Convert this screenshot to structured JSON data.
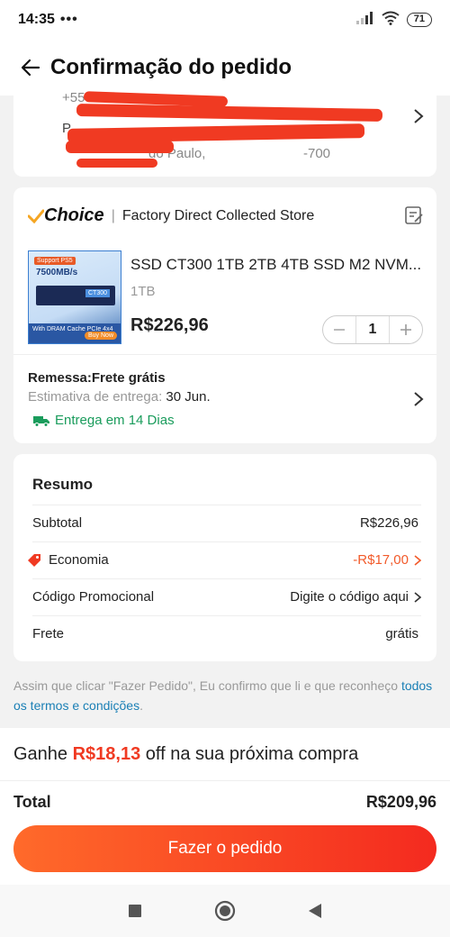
{
  "status_bar": {
    "time": "14:35",
    "dots": "•••",
    "battery": "71"
  },
  "header": {
    "title": "Confirmação do pedido"
  },
  "address": {
    "phone_partial": "+55 ",
    "line2_partial": "P",
    "line3_partial": "do Paulo, ",
    "line3_suffix": "-700"
  },
  "store": {
    "brand": "Choice",
    "separator": "|",
    "name": "Factory Direct Collected Store"
  },
  "product": {
    "title": "SSD CT300 1TB 2TB 4TB SSD M2 NVM...",
    "variant": "1TB",
    "price": "R$226,96",
    "quantity": "1",
    "image_texts": {
      "tag": "Support PS5",
      "speed": "7500MB/s",
      "label": "CT300",
      "bottom": "With DRAM Cache PCIe 4x4",
      "buy": "Buy Now"
    }
  },
  "shipping": {
    "title": "Remessa:Frete grátis",
    "estimate_label": "Estimativa de entrega: ",
    "estimate_date": "30 Jun.",
    "delivery_days": "Entrega em 14 Dias"
  },
  "summary": {
    "title": "Resumo",
    "rows": [
      {
        "label": "Subtotal",
        "value": "R$226,96"
      },
      {
        "label": "Economia",
        "value": "-R$17,00"
      },
      {
        "label": "Código Promocional",
        "value": "Digite o código aqui"
      },
      {
        "label": "Frete",
        "value": "grátis"
      }
    ]
  },
  "legal": {
    "text": "Assim que clicar \"Fazer Pedido\", Eu confirmo que li e que reconheço ",
    "link": "todos os termos e condições",
    "end": "."
  },
  "bottom": {
    "earn_prefix": "Ganhe ",
    "earn_amount": "R$18,13",
    "earn_suffix": " off na sua próxima compra",
    "total_label": "Total",
    "total_value": "R$209,96",
    "order_button": "Fazer o pedido"
  },
  "colors": {
    "accent": "#f03a22",
    "success": "#1a9c5c",
    "link": "#1a7fb5",
    "choice_check": "#f5a623"
  },
  "icons": [
    "back-arrow-icon",
    "wifi-icon",
    "signal-icon",
    "chevron-right-icon",
    "note-edit-icon",
    "truck-icon",
    "coupon-tag-icon",
    "nav-square-icon",
    "nav-circle-icon",
    "nav-back-triangle-icon"
  ]
}
